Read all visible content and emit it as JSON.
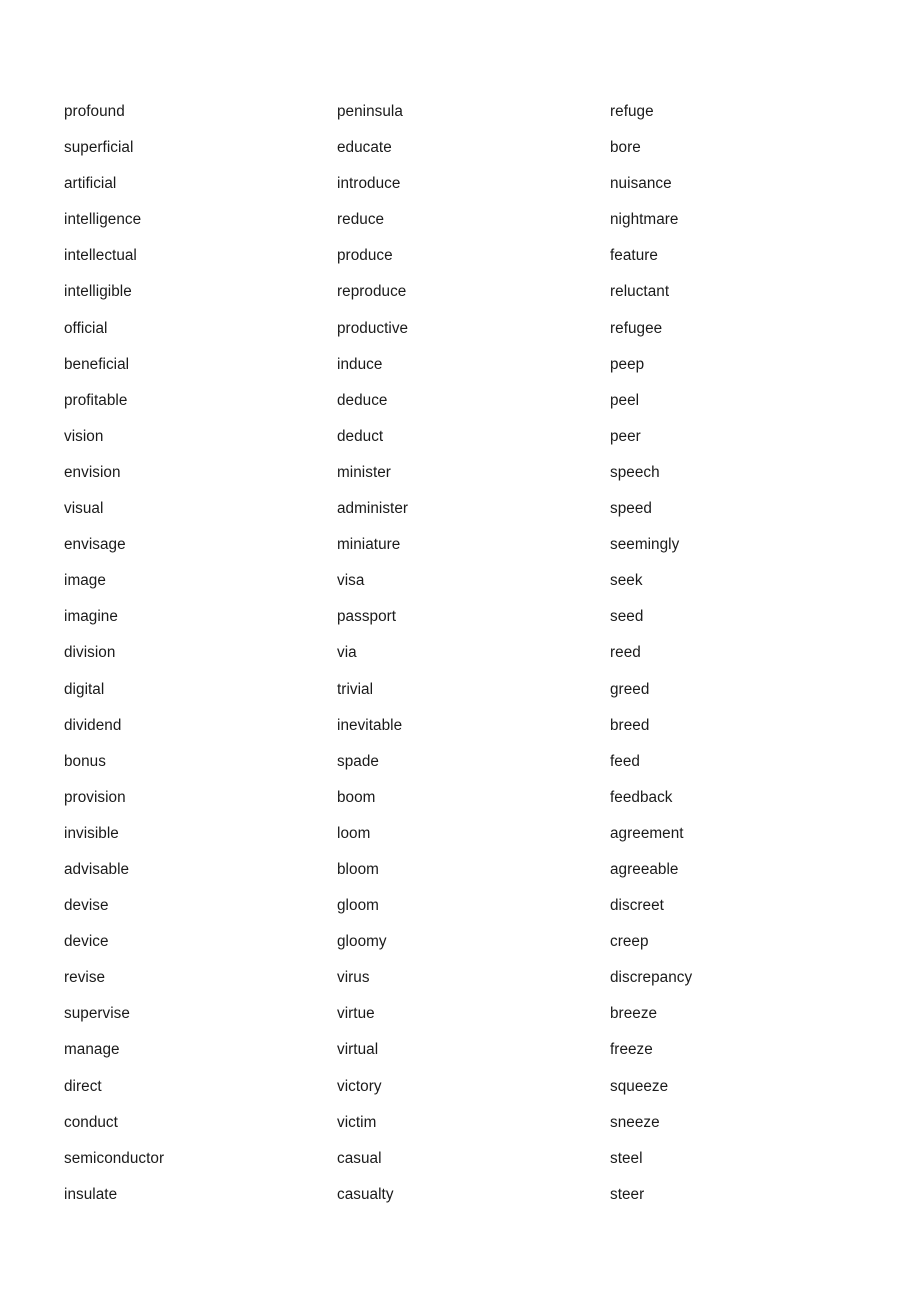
{
  "document": {
    "type": "vocabulary-word-list",
    "page_background": "#ffffff",
    "text_color": "#1a1a1a",
    "column_count": 3,
    "rows_per_column": 31,
    "total_words": 93
  },
  "columns": [
    {
      "index": 1,
      "words": [
        "profound",
        "superficial",
        "artificial",
        "intelligence",
        "intellectual",
        "intelligible",
        "official",
        "beneficial",
        "profitable",
        "vision",
        "envision",
        "visual",
        "envisage",
        "image",
        "imagine",
        "division",
        "digital",
        "dividend",
        "bonus",
        "provision",
        "invisible",
        "advisable",
        "devise",
        "device",
        "revise",
        "supervise",
        "manage",
        "direct",
        "conduct",
        "semiconductor",
        "insulate"
      ]
    },
    {
      "index": 2,
      "words": [
        "peninsula",
        "educate",
        "introduce",
        "reduce",
        "produce",
        "reproduce",
        "productive",
        "induce",
        "deduce",
        "deduct",
        "minister",
        "administer",
        "miniature",
        "visa",
        "passport",
        "via",
        "trivial",
        "inevitable",
        "spade",
        "boom",
        "loom",
        "bloom",
        "gloom",
        "gloomy",
        "virus",
        "virtue",
        "virtual",
        "victory",
        "victim",
        "casual",
        "casualty"
      ]
    },
    {
      "index": 3,
      "words": [
        "refuge",
        "bore",
        "nuisance",
        "nightmare",
        "feature",
        "reluctant",
        "refugee",
        "peep",
        "peel",
        "peer",
        "speech",
        "speed",
        "seemingly",
        "seek",
        "seed",
        "reed",
        "greed",
        "breed",
        "feed",
        "feedback",
        "agreement",
        "agreeable",
        "discreet",
        "creep",
        "discrepancy",
        "breeze",
        "freeze",
        "squeeze",
        "sneeze",
        "steel",
        "steer"
      ]
    }
  ]
}
